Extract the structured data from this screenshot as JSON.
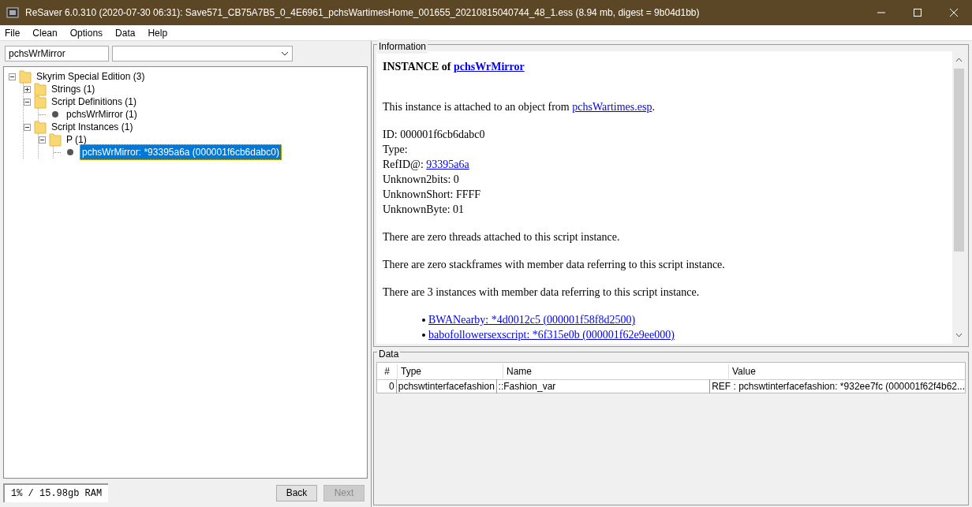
{
  "window": {
    "title": "ReSaver 6.0.310 (2020-07-30 06:31): Save571_CB75A7B5_0_4E6961_pchsWartimesHome_001655_20210815040744_48_1.ess (8.94 mb, digest = 9b04d1bb)"
  },
  "menu": [
    "File",
    "Clean",
    "Options",
    "Data",
    "Help"
  ],
  "filter": {
    "value": "pchsWrMirror"
  },
  "tree": [
    {
      "label": "Skyrim Special Edition (3)",
      "kind": "folder",
      "expanded": true,
      "selected": false,
      "children": [
        {
          "label": "Strings (1)",
          "kind": "folder",
          "expanded": false,
          "selected": false
        },
        {
          "label": "Script Definitions (1)",
          "kind": "folder",
          "expanded": true,
          "selected": false,
          "children": [
            {
              "label": "pchsWrMirror (1)",
              "kind": "leaf",
              "selected": false
            }
          ]
        },
        {
          "label": "Script Instances (1)",
          "kind": "folder",
          "expanded": true,
          "selected": false,
          "children": [
            {
              "label": "P (1)",
              "kind": "folder",
              "expanded": true,
              "selected": false,
              "children": [
                {
                  "label": "pchsWrMirror: *93395a6a (000001f6cb6dabc0)",
                  "kind": "leaf",
                  "selected": true
                }
              ]
            }
          ]
        }
      ]
    }
  ],
  "memory": "1% / 15.98gb RAM",
  "buttons": [
    {
      "label": "Back",
      "disabled": false
    },
    {
      "label": "Next",
      "disabled": true
    }
  ],
  "information": {
    "title": "Information",
    "blocks": [
      {
        "kind": "heading",
        "text": "INSTANCE of ",
        "link": "pchsWrMirror"
      },
      {
        "kind": "paragraph",
        "text": "This instance is attached to an object from ",
        "link": "pchsWartimes.esp",
        "after": "."
      },
      {
        "kind": "lines",
        "lines": [
          {
            "text": "ID: 000001f6cb6dabc0"
          },
          {
            "text": "Type:"
          },
          {
            "text": "RefID@: ",
            "link": "93395a6a"
          },
          {
            "text": "Unknown2bits: 0"
          },
          {
            "text": "UnknownShort: FFFF"
          },
          {
            "text": "UnknownByte: 01"
          }
        ]
      },
      {
        "kind": "paragraph",
        "text": "There are zero threads attached to this script instance."
      },
      {
        "kind": "paragraph",
        "text": "There are zero stackframes with member data referring to this script instance."
      },
      {
        "kind": "paragraph",
        "text": "There are 3 instances with member data referring to this script instance."
      },
      {
        "kind": "list",
        "items": [
          "BWANearby: *4d0012c5 (000001f58f8d2500)",
          "babofollowersexscript: *6f315e0b (000001f62e9ee000)"
        ]
      }
    ]
  },
  "data": {
    "title": "Data",
    "columns": [
      "#",
      "Type",
      "Name",
      "Value"
    ],
    "rows": [
      [
        "0",
        "pchswtinterfacefashion",
        "::Fashion_var",
        "REF : pchswtinterfacefashion: *932ee7fc (000001f62f4b62..."
      ]
    ]
  }
}
